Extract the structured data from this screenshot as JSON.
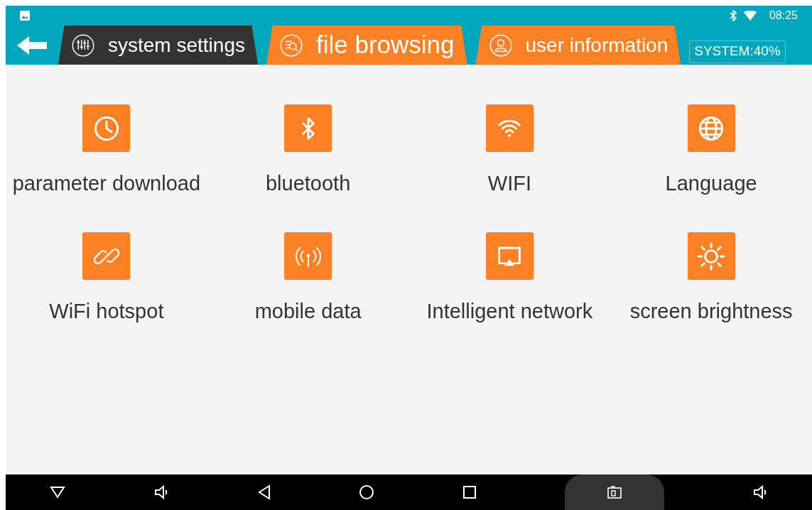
{
  "status_bar": {
    "time": "08:25"
  },
  "tabs": [
    {
      "label": "system settings",
      "selected": true
    },
    {
      "label": "file browsing",
      "selected": false
    },
    {
      "label": "user information",
      "selected": false
    }
  ],
  "battery": {
    "label": "SYSTEM:40%"
  },
  "items": [
    {
      "label": "parameter download"
    },
    {
      "label": "bluetooth"
    },
    {
      "label": "WIFI"
    },
    {
      "label": "Language"
    },
    {
      "label": "WiFi hotspot"
    },
    {
      "label": "mobile data"
    },
    {
      "label": "Intelligent network"
    },
    {
      "label": "screen brightness"
    }
  ]
}
